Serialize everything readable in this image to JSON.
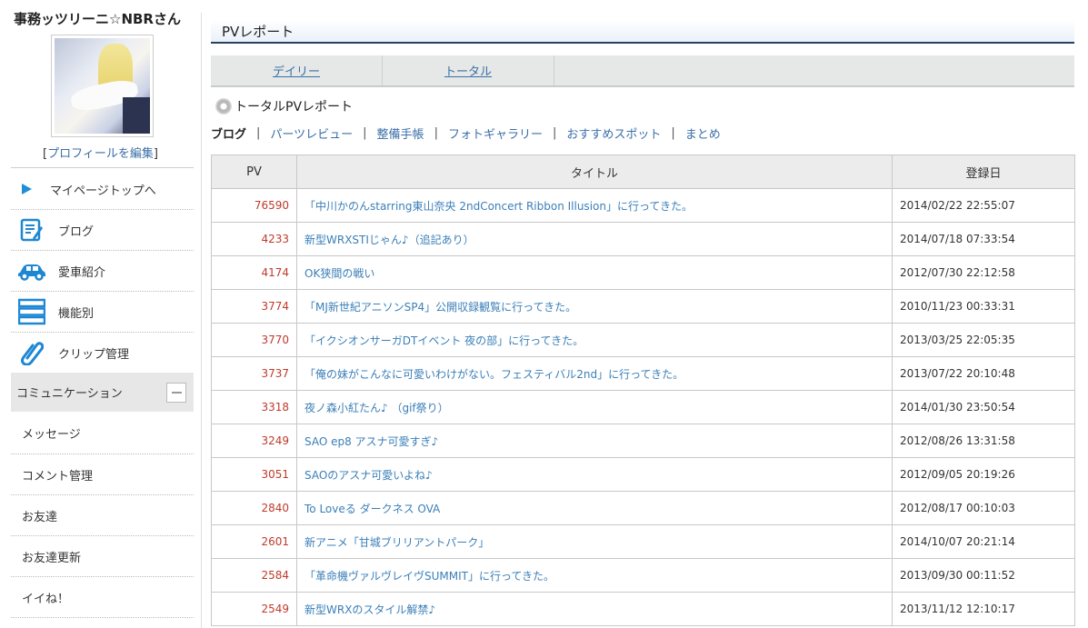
{
  "sidebar": {
    "username": "事務ッツリーニ☆NBRさん",
    "edit_profile": "プロフィールを編集",
    "nav": [
      {
        "label": "マイページトップへ",
        "icon": "triangle-right-icon"
      },
      {
        "label": "ブログ",
        "icon": "blog-notepad-icon"
      },
      {
        "label": "愛車紹介",
        "icon": "car-icon"
      },
      {
        "label": "機能別",
        "icon": "list-stack-icon"
      },
      {
        "label": "クリップ管理",
        "icon": "paperclip-icon"
      }
    ],
    "communication": {
      "label": "コミュニケーション",
      "items": [
        "メッセージ",
        "コメント管理",
        "お友達",
        "お友達更新",
        "イイね！"
      ]
    }
  },
  "main": {
    "title": "PVレポート",
    "tabs": [
      "デイリー",
      "トータル"
    ],
    "report_heading": "トータルPVレポート",
    "categories": [
      "ブログ",
      "パーツレビュー",
      "整備手帳",
      "フォトギャラリー",
      "おすすめスポット",
      "まとめ"
    ],
    "table": {
      "headers": [
        "PV",
        "タイトル",
        "登録日"
      ],
      "rows": [
        {
          "pv": "76590",
          "title": "「中川かのんstarring東山奈央 2ndConcert Ribbon Illusion」に行ってきた。",
          "date": "2014/02/22 22:55:07"
        },
        {
          "pv": "4233",
          "title": "新型WRXSTIじゃん♪（追記あり）",
          "date": "2014/07/18 07:33:54"
        },
        {
          "pv": "4174",
          "title": "OK狭間の戦い",
          "date": "2012/07/30 22:12:58"
        },
        {
          "pv": "3774",
          "title": "「MJ新世紀アニソンSP4」公開収録観覧に行ってきた。",
          "date": "2010/11/23 00:33:31"
        },
        {
          "pv": "3770",
          "title": "「イクシオンサーガDTイベント 夜の部」に行ってきた。",
          "date": "2013/03/25 22:05:35"
        },
        {
          "pv": "3737",
          "title": "「俺の妹がこんなに可愛いわけがない。フェスティバル2nd」に行ってきた。",
          "date": "2013/07/22 20:10:48"
        },
        {
          "pv": "3318",
          "title": "夜ノ森小紅たん♪ （gif祭り）",
          "date": "2014/01/30 23:50:54"
        },
        {
          "pv": "3249",
          "title": "SAO ep8 アスナ可愛すぎ♪",
          "date": "2012/08/26 13:31:58"
        },
        {
          "pv": "3051",
          "title": "SAOのアスナ可愛いよね♪",
          "date": "2012/09/05 20:19:26"
        },
        {
          "pv": "2840",
          "title": "To Loveる ダークネス OVA",
          "date": "2012/08/17 00:10:03"
        },
        {
          "pv": "2601",
          "title": "新アニメ「甘城ブリリアントパーク」",
          "date": "2014/10/07 20:21:14"
        },
        {
          "pv": "2584",
          "title": "「革命機ヴァルヴレイヴSUMMIT」に行ってきた。",
          "date": "2013/09/30 00:11:52"
        },
        {
          "pv": "2549",
          "title": "新型WRXのスタイル解禁♪",
          "date": "2013/11/12 12:10:17"
        }
      ]
    }
  }
}
